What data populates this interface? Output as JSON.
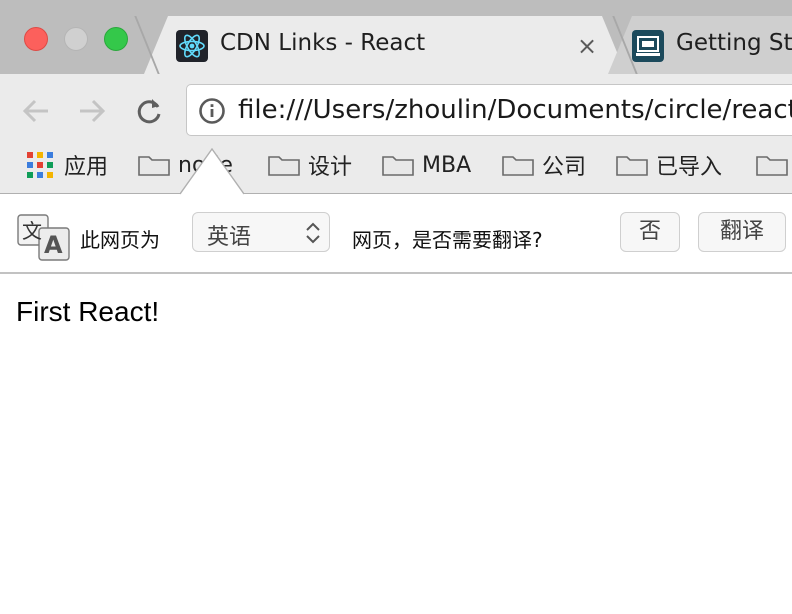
{
  "tabs": [
    {
      "title": "CDN Links - React",
      "favicon": "react-logo-icon",
      "close": "×"
    },
    {
      "title": "Getting Sta",
      "favicon": "laptop-icon"
    }
  ],
  "toolbar": {
    "url": "file:///Users/zhoulin/Documents/circle/react"
  },
  "bookmarks": {
    "apps_label": "应用",
    "folders": [
      "node",
      "设计",
      "MBA",
      "公司",
      "已导入"
    ]
  },
  "translate_bar": {
    "prefix": "此网页为",
    "language": "英语",
    "question": "网页，是否需要翻译?",
    "no_label": "否",
    "translate_label": "翻译",
    "icon_char_zh": "文",
    "icon_char_en": "A"
  },
  "page": {
    "text": "First React!"
  },
  "colors": {
    "titlebar": "#bdbdbd",
    "toolbar": "#ebebeb",
    "close_light": "#fc605c",
    "maximize_light": "#34c84a",
    "react_cyan": "#61dafb"
  }
}
